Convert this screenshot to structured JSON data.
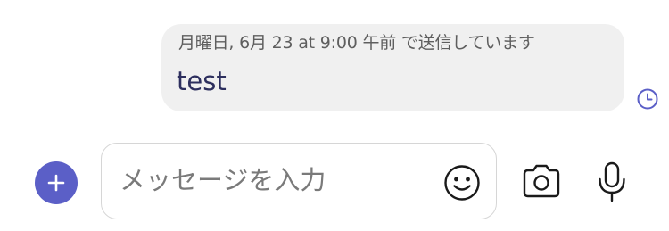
{
  "message": {
    "status_text": "月曜日, 6月 23 at 9:00 午前 で送信しています",
    "body": "test",
    "status_icon": "clock-icon"
  },
  "composer": {
    "placeholder": "メッセージを入力",
    "add_icon": "plus-icon",
    "emoji_icon": "smiley-icon",
    "camera_icon": "camera-icon",
    "mic_icon": "microphone-icon"
  },
  "colors": {
    "accent": "#5b5fc7",
    "bubble_bg": "#f0f0f0",
    "message_text": "#2d2f5e",
    "status_text": "#5e5e5e",
    "placeholder_text": "#7a7a7a",
    "input_border": "#d6d6d6"
  }
}
